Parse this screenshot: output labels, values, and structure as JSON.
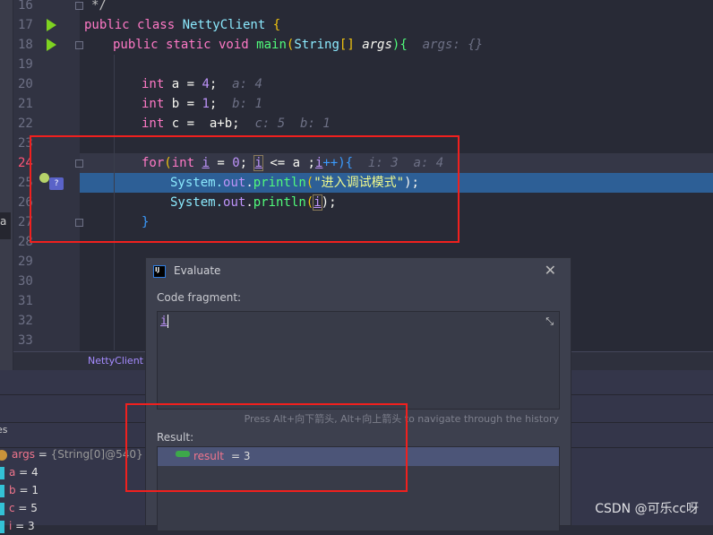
{
  "editor": {
    "lines": [
      {
        "n": "16"
      },
      {
        "n": "17"
      },
      {
        "n": "18"
      },
      {
        "n": "19"
      },
      {
        "n": "20"
      },
      {
        "n": "21"
      },
      {
        "n": "22"
      },
      {
        "n": "23"
      },
      {
        "n": "24"
      },
      {
        "n": "25"
      },
      {
        "n": "26"
      },
      {
        "n": "27"
      },
      {
        "n": "28"
      },
      {
        "n": "29"
      },
      {
        "n": "30"
      },
      {
        "n": "31"
      },
      {
        "n": "32"
      },
      {
        "n": "33"
      }
    ],
    "code": {
      "l16": "*/",
      "l17_kw": "public class ",
      "l17_cls": "NettyClient ",
      "l17_brace": "{",
      "l18_kw": "public static void ",
      "l18_fn": "main",
      "l18_p1": "(",
      "l18_type": "String",
      "l18_rest": "[] ",
      "l18_arg": "args",
      "l18_p2": "){",
      "l18_hint": "args: {}",
      "l20_kw": "int ",
      "l20_code": "a = ",
      "l20_num": "4",
      ";": ";",
      "l20_hint": "a: 4",
      "l21_kw": "int ",
      "l21_code": "b = ",
      "l21_num": "1",
      "l21_hint": "b: 1",
      "l22_kw": "int ",
      "l22_code": "c =  a+b;",
      "l22_hint": "c: 5  b: 1",
      "l24_for": "for",
      "l24_kw": "int ",
      "l24_i": "i",
      "l24_eq": " = ",
      "l24_zero": "0",
      "l24_semi": "; ",
      "l24_cond": " <= a ;",
      "l24_inc": "++){",
      "l24_hint": "i: 3  a: 4",
      "l25_sys": "System.",
      "l25_out": "out",
      "l25_dot": ".",
      "l25_fn": "println",
      "l25_str": "\"进入调试模式\"",
      "l25_end": ");",
      "l26_end": ");",
      "l27": "}"
    },
    "current_line": "25",
    "file_breadcrumb": "NettyClient"
  },
  "variables": {
    "header": "es",
    "items": [
      {
        "name": "args",
        "value": "{String[0]@540}"
      },
      {
        "name": "a",
        "value": "4"
      },
      {
        "name": "b",
        "value": "1"
      },
      {
        "name": "c",
        "value": "5"
      },
      {
        "name": "i",
        "value": "3"
      }
    ],
    "left_letter": "a"
  },
  "dialog": {
    "title": "Evaluate",
    "logo": "IJ",
    "code_fragment_label": "Code fragment:",
    "code_fragment_value": "i",
    "hint": "Press Alt+向下箭头, Alt+向上箭头 to navigate through the history",
    "result_label": "Result:",
    "result_name": "result",
    "result_value": "= 3",
    "close_icon": "close-icon",
    "collapse_icon": "collapse-icon"
  },
  "watermark": "CSDN @可乐cc呀",
  "colors": {
    "highlight": "#2d5f96",
    "annotation": "#f0201e",
    "selection": "#4c5578"
  }
}
